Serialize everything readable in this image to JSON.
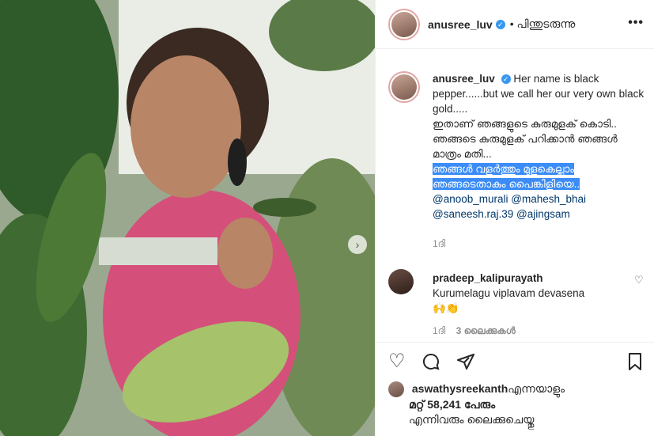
{
  "post": {
    "username": "anusree_luv",
    "follow_label": "• പിന്തുടരുന്നു",
    "more_label": "•••"
  },
  "caption": {
    "username": "anusree_luv",
    "text_line1": "Her name is black pepper......but we call her our very own black gold.....",
    "text_line2": "ഇതാണ് ഞങ്ങളുടെ കുരുമുളക് കൊടി.. ഞങ്ങടെ കുരുമുളക് പറിക്കാൻ ഞങ്ങൾ മാത്രം മതി...",
    "text_highlight": "ഞങ്ങൾ വളർത്തും മുളകെല്ലാം ഞങ്ങടെതാകും പൈങ്കിളിയെ..",
    "mentions": [
      "@anoob_murali",
      "@mahesh_bhai",
      "@saneesh.raj.39",
      "@ajingsam"
    ],
    "time": "1ദി"
  },
  "comment": {
    "username": "pradeep_kalipurayath",
    "text": "Kurumelagu viplavam devasena",
    "emoji": "🙌👏",
    "time": "1ദി",
    "likes": "3 ലൈക്കുകൾ"
  },
  "likes_section": {
    "liker": "aswathysreekanth",
    "liker_suffix": "എന്നയാളും",
    "others": "മറ്റ് 58,241 പേരും",
    "liked_by": "എന്നിവരും ലൈക്കുചെയ്തു"
  },
  "icons": {
    "heart": "heart-icon",
    "comment": "comment-icon",
    "share": "share-icon",
    "save": "bookmark-icon",
    "verified": "verified-badge-icon"
  },
  "colors": {
    "highlight": "#3b8cf7",
    "mention": "#00376b",
    "verified": "#3897f0"
  }
}
